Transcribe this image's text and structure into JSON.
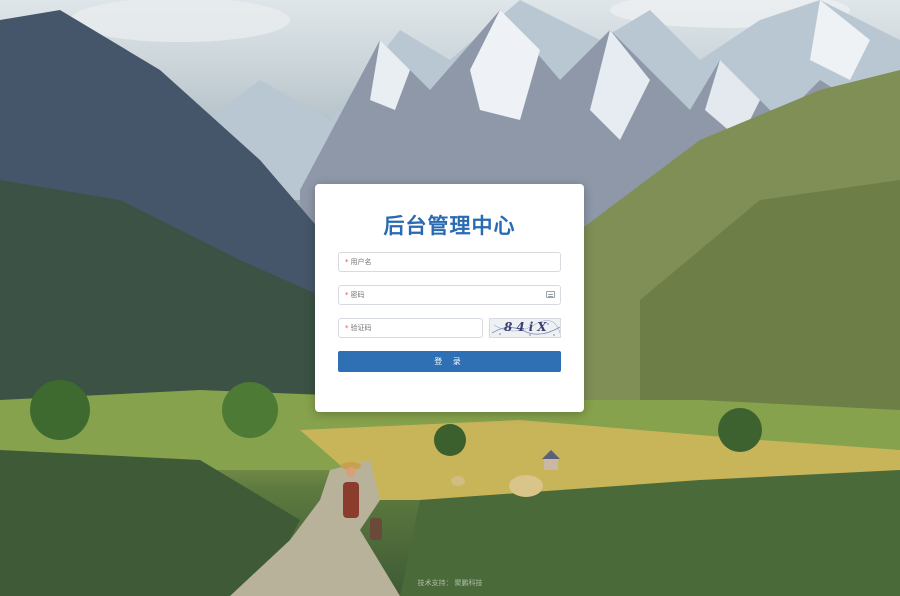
{
  "login": {
    "title": "后台管理中心",
    "username_placeholder": "用户名",
    "password_placeholder": "密码",
    "captcha_placeholder": "验证码",
    "required_mark": "*",
    "captcha_text": "84iX",
    "submit_label": "登 录"
  },
  "footer": {
    "label": "技术支持：",
    "provider": "聚鹏科技"
  },
  "colors": {
    "title": "#2a6ab1",
    "button": "#2f6fb4",
    "required": "#e0534a"
  },
  "icons": {
    "password_field": "keyboard-icon"
  }
}
